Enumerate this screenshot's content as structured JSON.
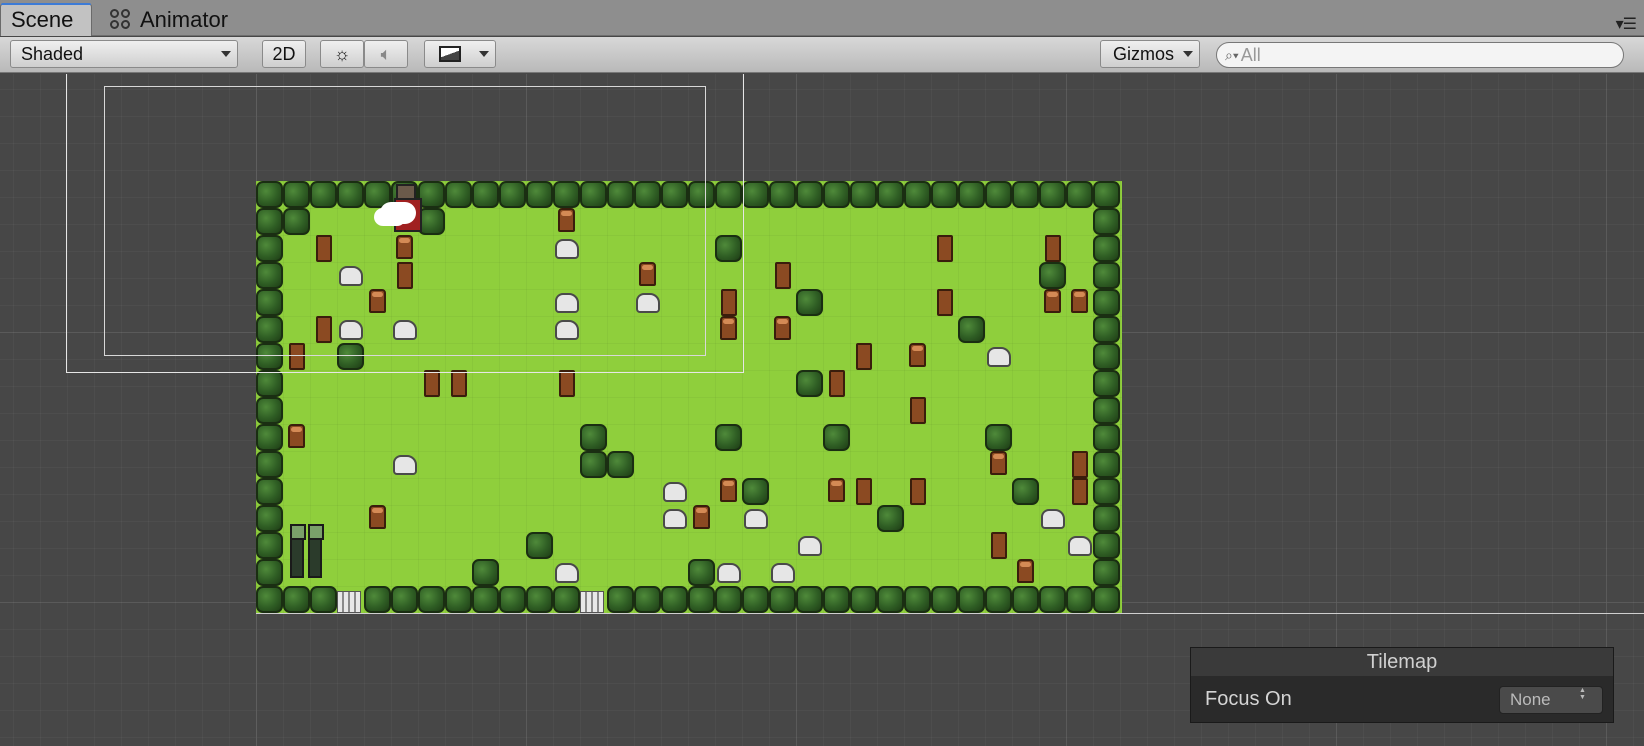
{
  "tabs": [
    {
      "label": "Scene",
      "icon": "none",
      "active": true
    },
    {
      "label": "Animator",
      "icon": "animator-icon",
      "active": false
    }
  ],
  "toolbar": {
    "shading_mode": "Shaded",
    "mode_2d": "2D",
    "gizmos": "Gizmos",
    "search_placeholder": "All",
    "icons": [
      "sun-icon",
      "audio-icon",
      "image-effects-icon"
    ]
  },
  "overlay": {
    "title": "Tilemap",
    "focus_label": "Focus On",
    "focus_value": "None"
  },
  "colors": {
    "grass": "#8fcf3c",
    "bush": "#2f5e24",
    "stump": "#8b4a22",
    "rock": "#e6e6e6",
    "selection_tab": "#3d7bd6"
  }
}
